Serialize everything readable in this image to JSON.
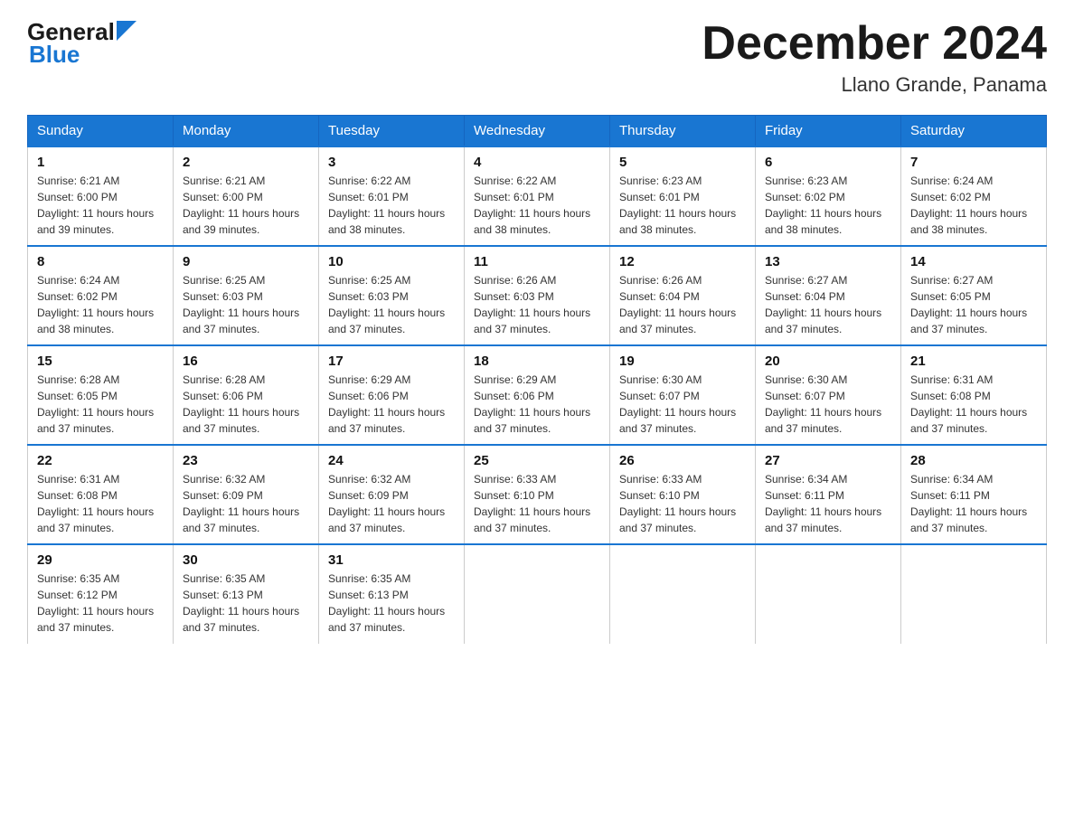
{
  "logo": {
    "text_general": "General",
    "text_blue": "Blue"
  },
  "title": "December 2024",
  "location": "Llano Grande, Panama",
  "days_of_week": [
    "Sunday",
    "Monday",
    "Tuesday",
    "Wednesday",
    "Thursday",
    "Friday",
    "Saturday"
  ],
  "weeks": [
    [
      {
        "day": "1",
        "sunrise": "6:21 AM",
        "sunset": "6:00 PM",
        "daylight": "11 hours and 39 minutes."
      },
      {
        "day": "2",
        "sunrise": "6:21 AM",
        "sunset": "6:00 PM",
        "daylight": "11 hours and 39 minutes."
      },
      {
        "day": "3",
        "sunrise": "6:22 AM",
        "sunset": "6:01 PM",
        "daylight": "11 hours and 38 minutes."
      },
      {
        "day": "4",
        "sunrise": "6:22 AM",
        "sunset": "6:01 PM",
        "daylight": "11 hours and 38 minutes."
      },
      {
        "day": "5",
        "sunrise": "6:23 AM",
        "sunset": "6:01 PM",
        "daylight": "11 hours and 38 minutes."
      },
      {
        "day": "6",
        "sunrise": "6:23 AM",
        "sunset": "6:02 PM",
        "daylight": "11 hours and 38 minutes."
      },
      {
        "day": "7",
        "sunrise": "6:24 AM",
        "sunset": "6:02 PM",
        "daylight": "11 hours and 38 minutes."
      }
    ],
    [
      {
        "day": "8",
        "sunrise": "6:24 AM",
        "sunset": "6:02 PM",
        "daylight": "11 hours and 38 minutes."
      },
      {
        "day": "9",
        "sunrise": "6:25 AM",
        "sunset": "6:03 PM",
        "daylight": "11 hours and 37 minutes."
      },
      {
        "day": "10",
        "sunrise": "6:25 AM",
        "sunset": "6:03 PM",
        "daylight": "11 hours and 37 minutes."
      },
      {
        "day": "11",
        "sunrise": "6:26 AM",
        "sunset": "6:03 PM",
        "daylight": "11 hours and 37 minutes."
      },
      {
        "day": "12",
        "sunrise": "6:26 AM",
        "sunset": "6:04 PM",
        "daylight": "11 hours and 37 minutes."
      },
      {
        "day": "13",
        "sunrise": "6:27 AM",
        "sunset": "6:04 PM",
        "daylight": "11 hours and 37 minutes."
      },
      {
        "day": "14",
        "sunrise": "6:27 AM",
        "sunset": "6:05 PM",
        "daylight": "11 hours and 37 minutes."
      }
    ],
    [
      {
        "day": "15",
        "sunrise": "6:28 AM",
        "sunset": "6:05 PM",
        "daylight": "11 hours and 37 minutes."
      },
      {
        "day": "16",
        "sunrise": "6:28 AM",
        "sunset": "6:06 PM",
        "daylight": "11 hours and 37 minutes."
      },
      {
        "day": "17",
        "sunrise": "6:29 AM",
        "sunset": "6:06 PM",
        "daylight": "11 hours and 37 minutes."
      },
      {
        "day": "18",
        "sunrise": "6:29 AM",
        "sunset": "6:06 PM",
        "daylight": "11 hours and 37 minutes."
      },
      {
        "day": "19",
        "sunrise": "6:30 AM",
        "sunset": "6:07 PM",
        "daylight": "11 hours and 37 minutes."
      },
      {
        "day": "20",
        "sunrise": "6:30 AM",
        "sunset": "6:07 PM",
        "daylight": "11 hours and 37 minutes."
      },
      {
        "day": "21",
        "sunrise": "6:31 AM",
        "sunset": "6:08 PM",
        "daylight": "11 hours and 37 minutes."
      }
    ],
    [
      {
        "day": "22",
        "sunrise": "6:31 AM",
        "sunset": "6:08 PM",
        "daylight": "11 hours and 37 minutes."
      },
      {
        "day": "23",
        "sunrise": "6:32 AM",
        "sunset": "6:09 PM",
        "daylight": "11 hours and 37 minutes."
      },
      {
        "day": "24",
        "sunrise": "6:32 AM",
        "sunset": "6:09 PM",
        "daylight": "11 hours and 37 minutes."
      },
      {
        "day": "25",
        "sunrise": "6:33 AM",
        "sunset": "6:10 PM",
        "daylight": "11 hours and 37 minutes."
      },
      {
        "day": "26",
        "sunrise": "6:33 AM",
        "sunset": "6:10 PM",
        "daylight": "11 hours and 37 minutes."
      },
      {
        "day": "27",
        "sunrise": "6:34 AM",
        "sunset": "6:11 PM",
        "daylight": "11 hours and 37 minutes."
      },
      {
        "day": "28",
        "sunrise": "6:34 AM",
        "sunset": "6:11 PM",
        "daylight": "11 hours and 37 minutes."
      }
    ],
    [
      {
        "day": "29",
        "sunrise": "6:35 AM",
        "sunset": "6:12 PM",
        "daylight": "11 hours and 37 minutes."
      },
      {
        "day": "30",
        "sunrise": "6:35 AM",
        "sunset": "6:13 PM",
        "daylight": "11 hours and 37 minutes."
      },
      {
        "day": "31",
        "sunrise": "6:35 AM",
        "sunset": "6:13 PM",
        "daylight": "11 hours and 37 minutes."
      },
      null,
      null,
      null,
      null
    ]
  ],
  "labels": {
    "sunrise": "Sunrise:",
    "sunset": "Sunset:",
    "daylight": "Daylight:"
  }
}
